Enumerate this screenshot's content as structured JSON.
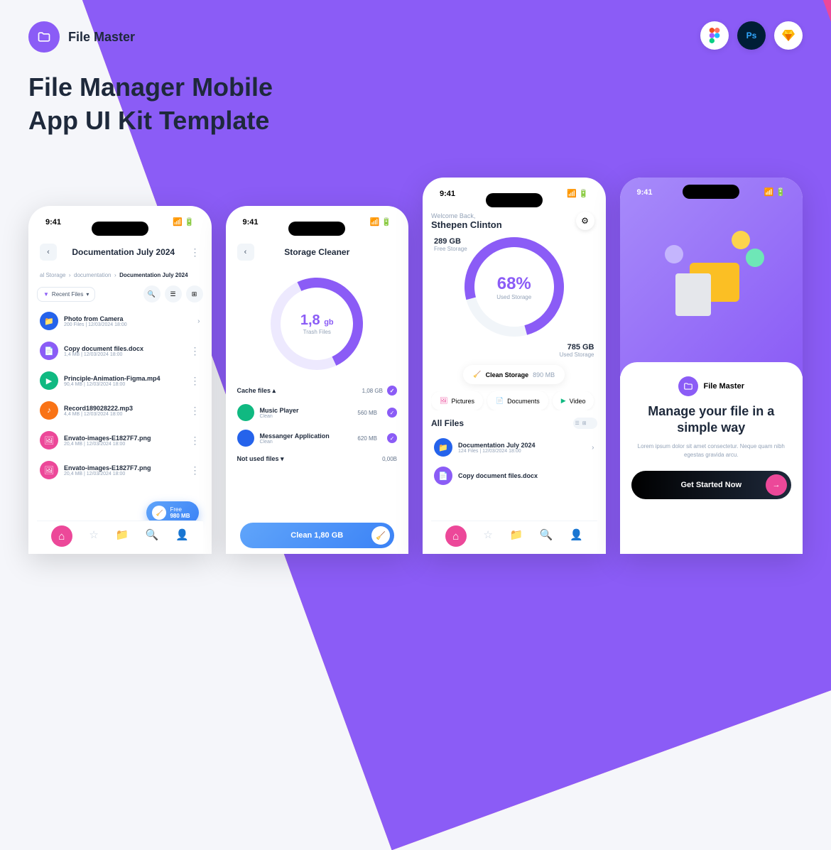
{
  "brand": "File Master",
  "headline": "File Manager Mobile\nApp UI Kit Template",
  "status_time": "9:41",
  "tools": [
    "figma",
    "photoshop",
    "sketch"
  ],
  "screen1": {
    "title": "Documentation July 2024",
    "breadcrumb": [
      "al Storage",
      "documentation",
      "Documentation July 2024"
    ],
    "filter": "Recent Files",
    "files": [
      {
        "name": "Photo from Camera",
        "meta": "200 Files | 12/03/2024 18:00",
        "color": "#2563eb",
        "icon": "folder"
      },
      {
        "name": "Copy document files.docx",
        "meta": "1,4 MB | 12/03/2024 18:00",
        "color": "#8b5cf6",
        "icon": "doc"
      },
      {
        "name": "Principle-Animation-Figma.mp4",
        "meta": "90,4 MB | 12/03/2024 18:00",
        "color": "#10b981",
        "icon": "play"
      },
      {
        "name": "Record189028222.mp3",
        "meta": "4,4 MB | 12/03/2024 18:00",
        "color": "#f97316",
        "icon": "music"
      },
      {
        "name": "Envato-images-E1827F7.png",
        "meta": "20,4 MB | 12/03/2024 18:00",
        "color": "#ec4899",
        "icon": "image"
      },
      {
        "name": "Envato-images-E1827F7.png",
        "meta": "20,4 MB | 12/03/2024 18:00",
        "color": "#ec4899",
        "icon": "image"
      }
    ],
    "fab": {
      "label": "Free",
      "value": "980 MB"
    }
  },
  "screen2": {
    "title": "Storage Cleaner",
    "trash": {
      "value": "1,8",
      "unit": "gb",
      "label": "Trash Files"
    },
    "cache_header": "Cache files",
    "cache_total": "1,08 GB",
    "apps": [
      {
        "name": "Music Player",
        "sub": "Clean",
        "size": "560 MB",
        "color": "#10b981"
      },
      {
        "name": "Messanger Application",
        "sub": "Clean",
        "size": "620 MB",
        "color": "#2563eb"
      }
    ],
    "notused": {
      "label": "Not used files",
      "size": "0,00B"
    },
    "clean_btn": "Clean 1,80 GB"
  },
  "screen3": {
    "welcome": "Welcome Back,",
    "user": "Sthepen Clinton",
    "free": {
      "val": "289 GB",
      "lbl": "Free Storage"
    },
    "used": {
      "val": "785 GB",
      "lbl": "Used Storage"
    },
    "pct": "68%",
    "pct_lbl": "Used Storage",
    "clean": {
      "label": "Clean Storage",
      "size": "890 MB"
    },
    "cats": [
      {
        "name": "Pictures",
        "color": "#ec4899"
      },
      {
        "name": "Documents",
        "color": "#8b5cf6"
      },
      {
        "name": "Video",
        "color": "#10b981"
      }
    ],
    "all_files": "All Files",
    "files": [
      {
        "name": "Documentation July 2024",
        "meta": "124 Files | 12/03/2024 18:00",
        "color": "#2563eb"
      },
      {
        "name": "Copy document files.docx",
        "meta": "",
        "color": "#8b5cf6"
      }
    ]
  },
  "screen4": {
    "brand": "File Master",
    "title": "Manage your file in a simple way",
    "desc": "Lorem ipsum dolor sit amet consectetur. Neque quam nibh egestas gravida arcu.",
    "btn": "Get Started Now"
  },
  "chart_data": {
    "type": "pie",
    "title": "Used Storage",
    "values": [
      {
        "name": "Used",
        "value": 68
      },
      {
        "name": "Free",
        "value": 32
      }
    ],
    "data_labels": {
      "free": "289 GB",
      "used": "785 GB"
    }
  }
}
